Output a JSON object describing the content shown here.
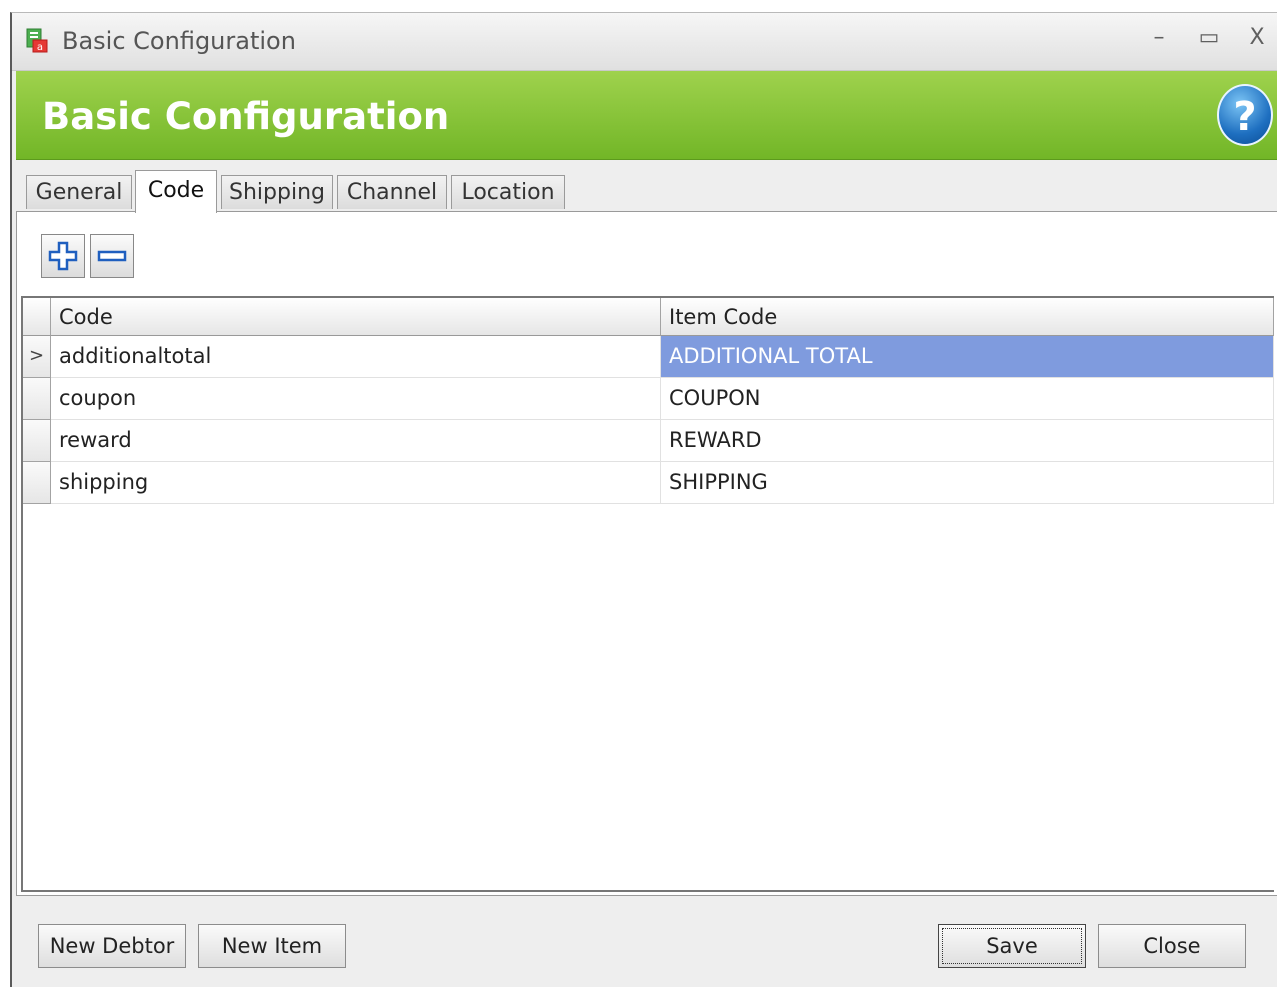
{
  "window": {
    "title": "Basic Configuration",
    "controls": [
      "–",
      "▭",
      "X"
    ]
  },
  "banner": {
    "title": "Basic Configuration",
    "help_glyph": "?"
  },
  "tabs": [
    {
      "label": "General",
      "active": false
    },
    {
      "label": "Code",
      "active": true
    },
    {
      "label": "Shipping",
      "active": false
    },
    {
      "label": "Channel",
      "active": false
    },
    {
      "label": "Location",
      "active": false
    }
  ],
  "toolbar": {
    "add_icon": "plus-icon",
    "remove_icon": "minus-icon"
  },
  "grid": {
    "columns": [
      "Code",
      "Item Code"
    ],
    "rows": [
      {
        "code": "additionaltotal",
        "item_code": "ADDITIONAL TOTAL",
        "selected": true
      },
      {
        "code": "coupon",
        "item_code": "COUPON",
        "selected": false
      },
      {
        "code": "reward",
        "item_code": "REWARD",
        "selected": false
      },
      {
        "code": "shipping",
        "item_code": "SHIPPING",
        "selected": false
      }
    ],
    "current_row_marker": ">"
  },
  "buttons": {
    "new_debtor": "New Debtor",
    "new_item": "New Item",
    "save": "Save",
    "close": "Close"
  },
  "colors": {
    "banner_green": "#72b627",
    "selection_blue": "#7f9bde",
    "help_blue": "#1e6fc0"
  }
}
